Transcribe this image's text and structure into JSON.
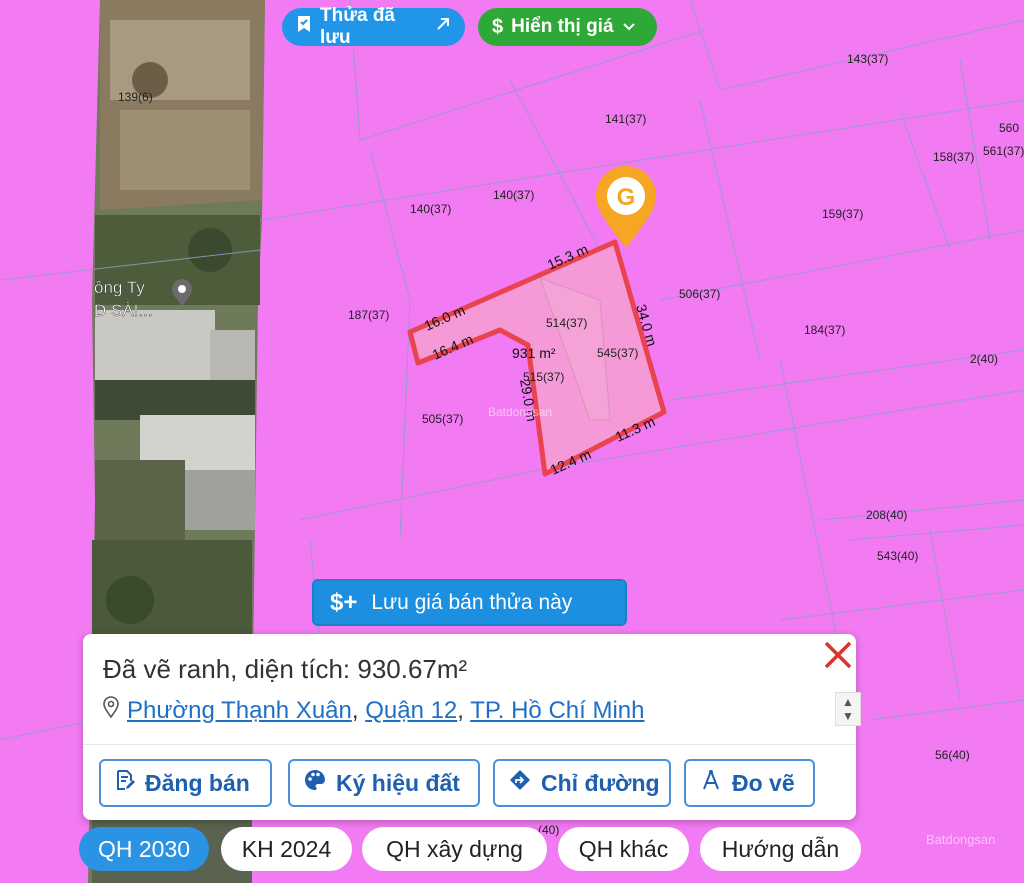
{
  "top_chips": {
    "saved_label": "Thửa đã lưu",
    "price_label": "Hiển thị giá"
  },
  "map": {
    "parcel_labels": [
      "139(6)",
      "143(37)",
      "141(37)",
      "560",
      "158(37)",
      "561(37)",
      "140(37)",
      "140(37)",
      "159(37)",
      "506(37)",
      "187(37)",
      "514(37)",
      "184(37)",
      "545(37)",
      "2(40)",
      "515(37)",
      "505(37)",
      "208(40)",
      "543(40)",
      "56(40)",
      "(40)"
    ],
    "area_label": "931 m²",
    "edge_lengths": [
      "15.3 m",
      "34.0 m",
      "16.0 m",
      "16.4 m",
      "29.0 m",
      "11.3 m",
      "12.4 m"
    ],
    "poi_label_line1": "ông Ty",
    "poi_label_line2": "D SÀI...",
    "watermark": "Batdongsan",
    "watermark_bottom": "Batdongsan",
    "marker_letter": "G"
  },
  "save_price_button": {
    "label": "Lưu giá bán thửa này",
    "icon": "$+"
  },
  "info_panel": {
    "title": "Đã vẽ ranh, diện tích: 930.67m²",
    "ward": "Phường Thạnh Xuân",
    "district": "Quận 12",
    "city": "TP. Hồ Chí Minh",
    "sep": ",",
    "actions": [
      "Đăng bán",
      "Ký hiệu đất",
      "Chỉ đường",
      "Đo vẽ"
    ]
  },
  "layers": [
    "QH 2030",
    "KH 2024",
    "QH xây dựng",
    "QH khác",
    "Hướng dẫn"
  ],
  "colors": {
    "zoning_pink": "#f27af2",
    "parcel_outline": "#e8434f",
    "accent_blue": "#2196e8",
    "accent_green": "#2ea836",
    "marker_orange": "#f5a623"
  }
}
